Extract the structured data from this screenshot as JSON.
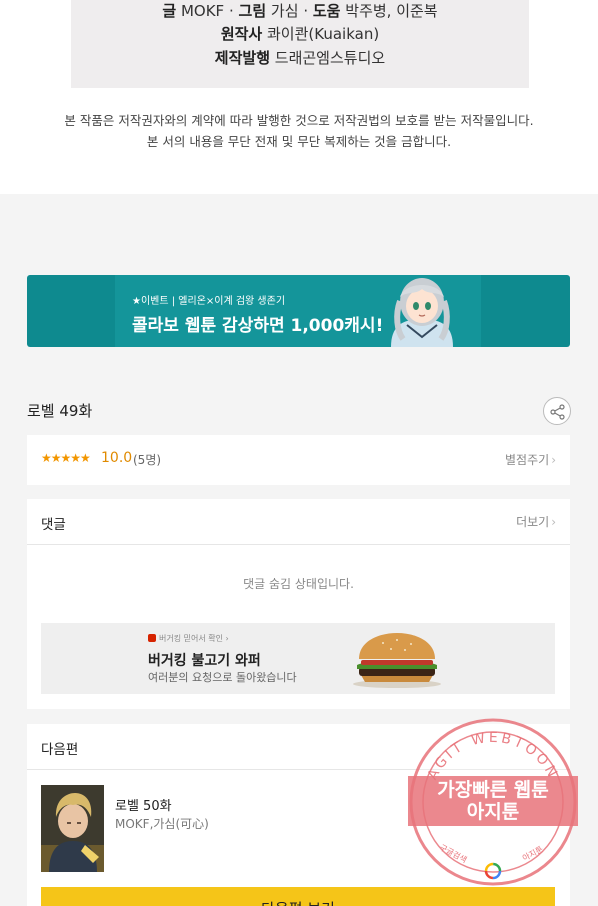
{
  "credits": {
    "writer_label": "글",
    "writer": "MOKF",
    "art_label": "그림",
    "art": "가심",
    "assist_label": "도움",
    "assist": "박주병, 이준복",
    "original_label": "원작사",
    "original": "콰이콴(Kuaikan)",
    "publisher_label": "제작발행",
    "publisher": "드래곤엠스튜디오"
  },
  "copyright": {
    "line1": "본 작품은 저작권자와의 계약에 따라 발행한 것으로 저작권법의 보호를 받는 저작물입니다.",
    "line2": "본 서의 내용을 무단 전재 및 무단 복제하는 것을 금합니다."
  },
  "banner": {
    "small": "★이벤트 | 엘리온×이계 검왕 생존기",
    "big": "콜라보 웹툰 감상하면 1,000캐시!"
  },
  "episode": {
    "title": "로벨 49화"
  },
  "rating": {
    "stars": "★★★★★",
    "score": "10.0",
    "count": "(5명)",
    "rate_link": "별점주기"
  },
  "comments": {
    "heading": "댓글",
    "more_link": "더보기",
    "hidden_message": "댓글 숨김 상태입니다."
  },
  "ad": {
    "small": "버거킹 믿어서 확인 ›",
    "title": "버거킹 불고기 와퍼",
    "subtitle": "여러분의 요청으로 돌아왔습니다"
  },
  "next_episode": {
    "heading": "다음편",
    "title": "로벨 50화",
    "author": "MOKF,가심(可心)",
    "button": "다음편 보기"
  },
  "watermark": {
    "arc_text": "AGIT WEBTOON",
    "line1": "가장빠른 웹툰",
    "line2": "아지툰",
    "bottom_left": "구글검색",
    "bottom_right": "아지툰"
  },
  "colors": {
    "banner_bg": "#0e8a8f",
    "star": "#f29600",
    "next_button": "#f5c518",
    "stamp": "#e8737a"
  }
}
